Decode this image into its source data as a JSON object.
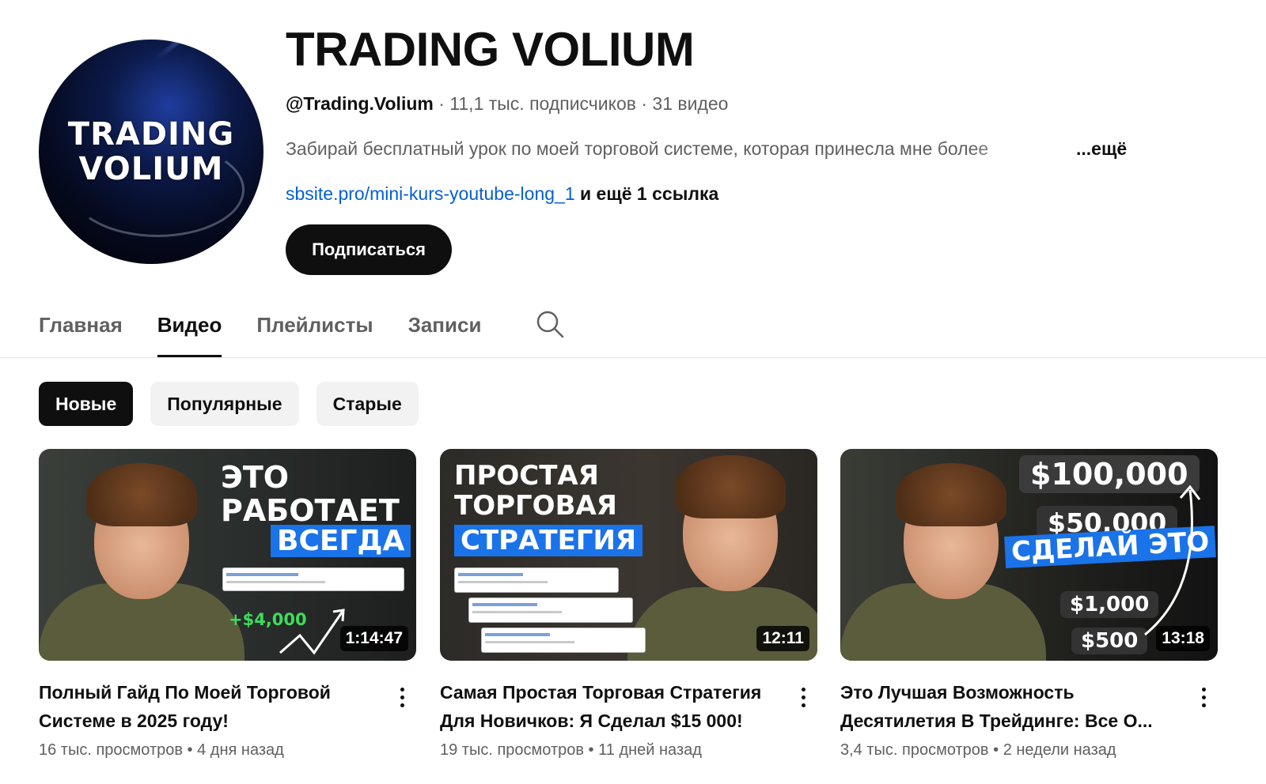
{
  "channel": {
    "avatar_text_line1": "TRADING",
    "avatar_text_line2": "VOLIUM",
    "title": "TRADING VOLIUM",
    "handle": "@Trading.Volium",
    "subscribers": "11,1 тыс. подписчиков",
    "videos_count": "31 видео",
    "separator": " · ",
    "description": "Забирай бесплатный урок по моей торговой системе, которая принесла мне более",
    "more_label": "...ещё",
    "link_url": "sbsite.pro/mini-kurs-youtube-long_1",
    "link_extra": " и ещё 1 ссылка",
    "subscribe_label": "Подписаться"
  },
  "tabs": [
    {
      "label": "Главная",
      "active": false
    },
    {
      "label": "Видео",
      "active": true
    },
    {
      "label": "Плейлисты",
      "active": false
    },
    {
      "label": "Записи",
      "active": false
    }
  ],
  "chips": [
    {
      "label": "Новые",
      "active": true
    },
    {
      "label": "Популярные",
      "active": false
    },
    {
      "label": "Старые",
      "active": false
    }
  ],
  "videos": [
    {
      "thumb_lines": [
        "ЭТО",
        "РАБОТАЕТ",
        "ВСЕГДА"
      ],
      "thumb_gain": "+$4,000",
      "duration": "1:14:47",
      "title": "Полный Гайд По Моей Торговой Системе в 2025 году!",
      "views": "16 тыс. просмотров",
      "age": "4 дня назад"
    },
    {
      "thumb_lines": [
        "ПРОСТАЯ",
        "ТОРГОВАЯ",
        "СТРАТЕГИЯ"
      ],
      "duration": "12:11",
      "title": "Самая Простая Торговая Стратегия Для Новичков: Я Сделал $15 000!",
      "views": "19 тыс. просмотров",
      "age": "11 дней назад"
    },
    {
      "thumb_amounts": [
        "$100,000",
        "$50,000",
        "$1,000",
        "$500"
      ],
      "thumb_banner": "СДЕЛАЙ ЭТО",
      "duration": "13:18",
      "title": "Это Лучшая Возможность Десятилетия В Трейдинге: Все О...",
      "views": "3,4 тыс. просмотров",
      "age": "2 недели назад"
    }
  ],
  "meta_separator": " • ",
  "colors": {
    "accent": "#0f0f0f",
    "link": "#065fd4",
    "highlight": "#1a73e8",
    "muted": "#606060"
  }
}
